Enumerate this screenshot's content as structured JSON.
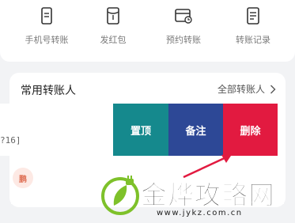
{
  "quick_actions": [
    {
      "label": "手机号转账",
      "icon": "phone-transfer-icon"
    },
    {
      "label": "发红包",
      "icon": "red-packet-icon"
    },
    {
      "label": "预约转账",
      "icon": "scheduled-transfer-icon"
    },
    {
      "label": "转账记录",
      "icon": "transfer-record-icon"
    }
  ],
  "frequent": {
    "title": "常用转账人",
    "all_link": "全部转账人"
  },
  "swiped_row": {
    "partial_text": "?16]",
    "actions": {
      "pin": "置顶",
      "note": "备注",
      "delete": "删除"
    }
  },
  "second_row": {
    "avatar_text": "鹏"
  },
  "colors": {
    "pin": "#15898d",
    "note": "#2d4896",
    "delete": "#e21a40",
    "arrow": "#e21a40"
  },
  "watermark": {
    "name": "金烨攻略网",
    "url": "www.jykz.com.cn"
  }
}
